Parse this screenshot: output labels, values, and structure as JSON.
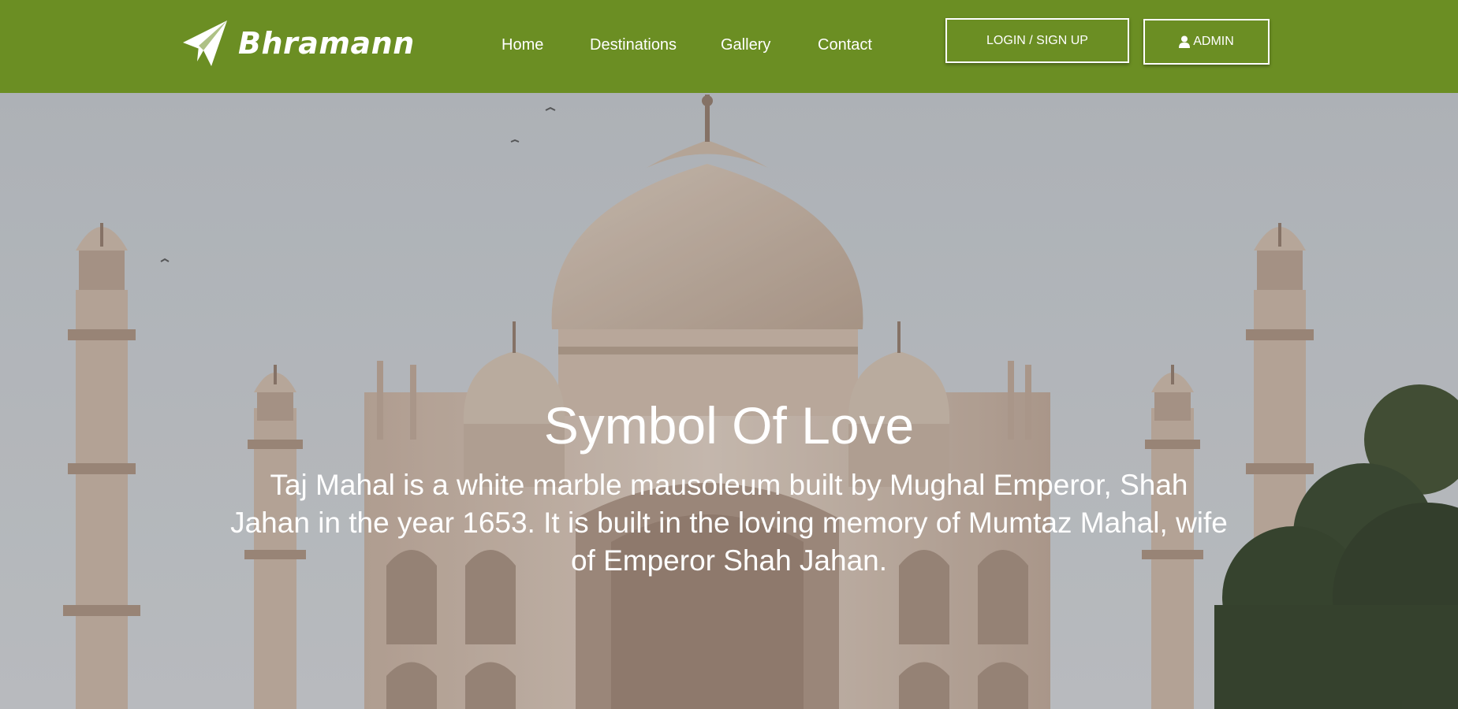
{
  "brand": {
    "name": "Bhramann",
    "icon": "paper-plane-icon"
  },
  "nav": {
    "items": [
      {
        "label": "Home"
      },
      {
        "label": "Destinations"
      },
      {
        "label": "Gallery"
      },
      {
        "label": "Contact"
      }
    ]
  },
  "actions": {
    "login_label": "LOGIN / SIGN UP",
    "admin_label": "ADMIN",
    "admin_icon": "user-icon"
  },
  "hero": {
    "title": "Symbol Of Love",
    "description": "Taj Mahal is a white marble mausoleum built by Mughal Emperor, Shah Jahan in the year 1653. It is built in the loving memory of Mumtaz Mahal, wife of Emperor Shah Jahan.",
    "background": "taj-mahal-photo"
  },
  "colors": {
    "header_bg": "#6b8e23",
    "text": "#ffffff"
  }
}
